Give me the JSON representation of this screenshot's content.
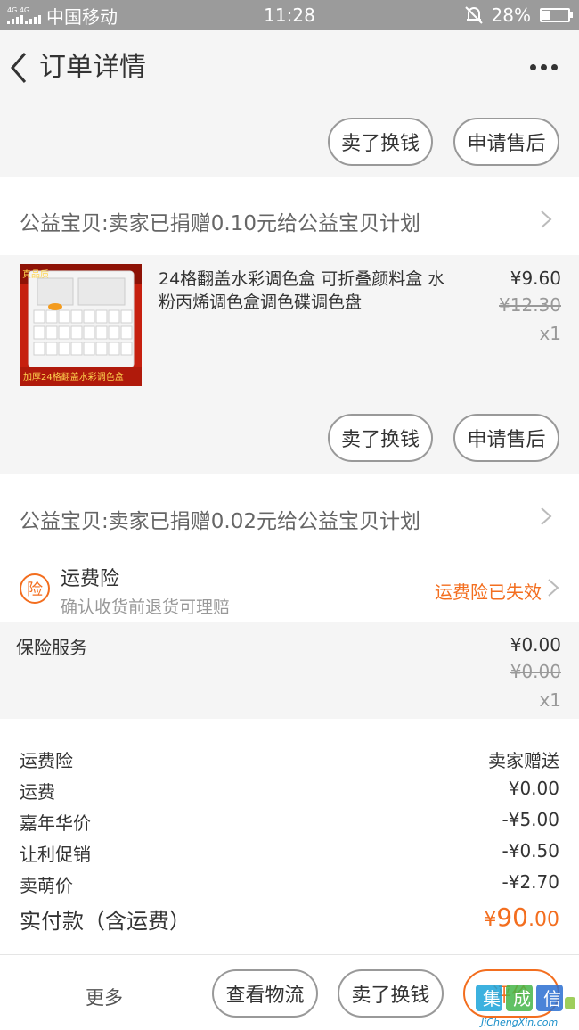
{
  "status_bar": {
    "network": "4G 4G",
    "carrier": "中国移动",
    "time": "11:28",
    "battery": "28%",
    "battery_level": 0.28
  },
  "nav": {
    "title": "订单详情"
  },
  "top_actions": {
    "sell_label": "卖了换钱",
    "after_sale_label": "申请售后"
  },
  "donation_1": "公益宝贝:卖家已捐赠0.10元给公益宝贝计划",
  "product": {
    "thumb_badge": "真品质",
    "thumb_caption": "加厚24格翻盖水彩调色盒",
    "name": "24格翻盖水彩调色盒 可折叠颜料盒 水粉丙烯调色盒调色碟调色盘",
    "price": "¥9.60",
    "original_price": "¥12.30",
    "quantity": "x1",
    "sell_label": "卖了换钱",
    "after_sale_label": "申请售后"
  },
  "donation_2": "公益宝贝:卖家已捐赠0.02元给公益宝贝计划",
  "insurance": {
    "icon_text": "险",
    "title": "运费险",
    "subtitle": "确认收货前退货可理赔",
    "status": "运费险已失效"
  },
  "service": {
    "label": "保险服务",
    "price": "¥0.00",
    "original_price": "¥0.00",
    "quantity": "x1"
  },
  "fees": [
    {
      "label": "运费险",
      "value": "卖家赠送"
    },
    {
      "label": "运费",
      "value": "¥0.00"
    },
    {
      "label": "嘉年华价",
      "value": "-¥5.00"
    },
    {
      "label": "让利促销",
      "value": "-¥0.50"
    },
    {
      "label": "卖萌价",
      "value": "-¥2.70"
    }
  ],
  "total": {
    "label": "实付款（含运费）",
    "currency": "¥",
    "integer": "90",
    "decimal": ".00"
  },
  "bottom_bar": {
    "more_label": "更多",
    "logistics_label": "查看物流",
    "sell_label": "卖了换钱",
    "evaluate_label": "评价"
  },
  "watermark": {
    "text": "JiChengXin.com"
  },
  "colors": {
    "accent": "#f36e1f",
    "status_bar": "#9b9b9b"
  }
}
